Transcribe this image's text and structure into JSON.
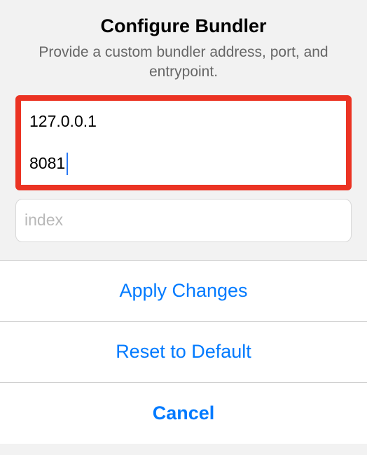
{
  "header": {
    "title": "Configure Bundler",
    "subtitle": "Provide a custom bundler address, port, and entrypoint."
  },
  "fields": {
    "address": {
      "value": "127.0.0.1",
      "placeholder": ""
    },
    "port": {
      "value": "8081",
      "placeholder": ""
    },
    "entrypoint": {
      "value": "",
      "placeholder": "index"
    }
  },
  "buttons": {
    "apply": "Apply Changes",
    "reset": "Reset to Default",
    "cancel": "Cancel"
  }
}
